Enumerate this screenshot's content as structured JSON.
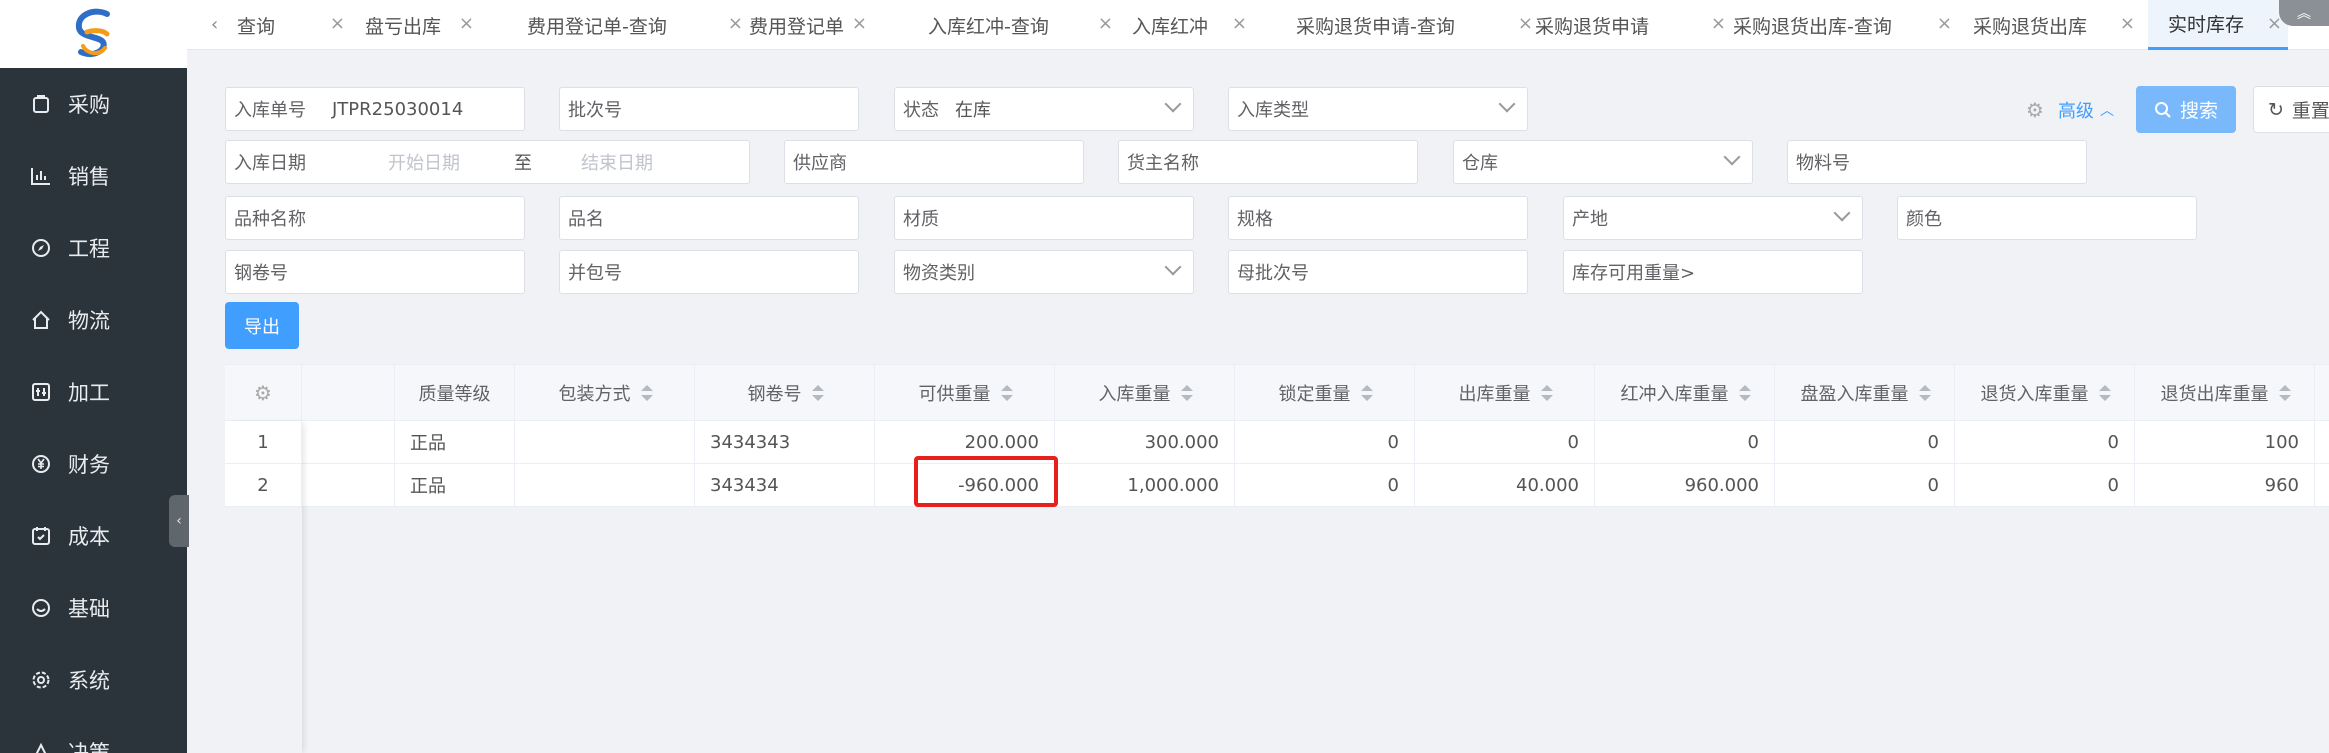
{
  "sidebar": {
    "items": [
      {
        "label": "采购",
        "icon": "purchase-icon"
      },
      {
        "label": "销售",
        "icon": "bar-chart-icon"
      },
      {
        "label": "工程",
        "icon": "compass-icon"
      },
      {
        "label": "物流",
        "icon": "home-icon"
      },
      {
        "label": "加工",
        "icon": "process-icon"
      },
      {
        "label": "财务",
        "icon": "yen-icon"
      },
      {
        "label": "成本",
        "icon": "cost-icon"
      },
      {
        "label": "基础",
        "icon": "smile-icon"
      },
      {
        "label": "系统",
        "icon": "gear-icon"
      },
      {
        "label": "决策",
        "icon": "decision-icon"
      }
    ]
  },
  "tabs": [
    {
      "label": "查询"
    },
    {
      "label": "盘亏出库"
    },
    {
      "label": "费用登记单-查询"
    },
    {
      "label": "费用登记单"
    },
    {
      "label": "入库红冲-查询"
    },
    {
      "label": "入库红冲"
    },
    {
      "label": "采购退货申请-查询"
    },
    {
      "label": "采购退货申请"
    },
    {
      "label": "采购退货出库-查询"
    },
    {
      "label": "采购退货出库"
    },
    {
      "label": "实时库存",
      "active": true
    }
  ],
  "filters": {
    "inbound_no": {
      "label": "入库单号",
      "value": "JTPR25030014"
    },
    "batch_no": {
      "label": "批次号"
    },
    "status": {
      "label": "状态",
      "value": "在库"
    },
    "inbound_type": {
      "label": "入库类型"
    },
    "inbound_date": {
      "label": "入库日期",
      "start_placeholder": "开始日期",
      "to": "至",
      "end_placeholder": "结束日期"
    },
    "supplier": {
      "label": "供应商"
    },
    "owner_name": {
      "label": "货主名称"
    },
    "warehouse": {
      "label": "仓库"
    },
    "material_no": {
      "label": "物料号"
    },
    "variety_name": {
      "label": "品种名称"
    },
    "product_name": {
      "label": "品名"
    },
    "material": {
      "label": "材质"
    },
    "spec": {
      "label": "规格"
    },
    "origin": {
      "label": "产地"
    },
    "color": {
      "label": "颜色"
    },
    "coil_no": {
      "label": "钢卷号"
    },
    "bundle_no": {
      "label": "并包号"
    },
    "goods_category": {
      "label": "物资类别"
    },
    "parent_batch_no": {
      "label": "母批次号"
    },
    "available_weight": {
      "label": "库存可用重量>"
    }
  },
  "actions": {
    "advanced": "高级",
    "search": "搜索",
    "reset": "重置",
    "export": "导出"
  },
  "table": {
    "columns": [
      "质量等级",
      "包装方式",
      "钢卷号",
      "可供重量",
      "入库重量",
      "锁定重量",
      "出库重量",
      "红冲入库重量",
      "盘盈入库重量",
      "退货入库重量",
      "退货出库重量"
    ],
    "rows": [
      {
        "index": "1",
        "quality": "正品",
        "packing": "",
        "coil": "3434343",
        "available": "200.000",
        "inbound": "300.000",
        "locked": "0",
        "outbound": "0",
        "red_inbound": "0",
        "surplus_inbound": "0",
        "return_inbound": "0",
        "return_outbound": "100"
      },
      {
        "index": "2",
        "quality": "正品",
        "packing": "",
        "coil": "343434",
        "available": "-960.000",
        "inbound": "1,000.000",
        "locked": "0",
        "outbound": "40.000",
        "red_inbound": "960.000",
        "surplus_inbound": "0",
        "return_inbound": "0",
        "return_outbound": "960"
      }
    ]
  },
  "colors": {
    "sidebar_bg": "#2b333b",
    "accent": "#409eff",
    "highlight_box": "#e8201c"
  }
}
